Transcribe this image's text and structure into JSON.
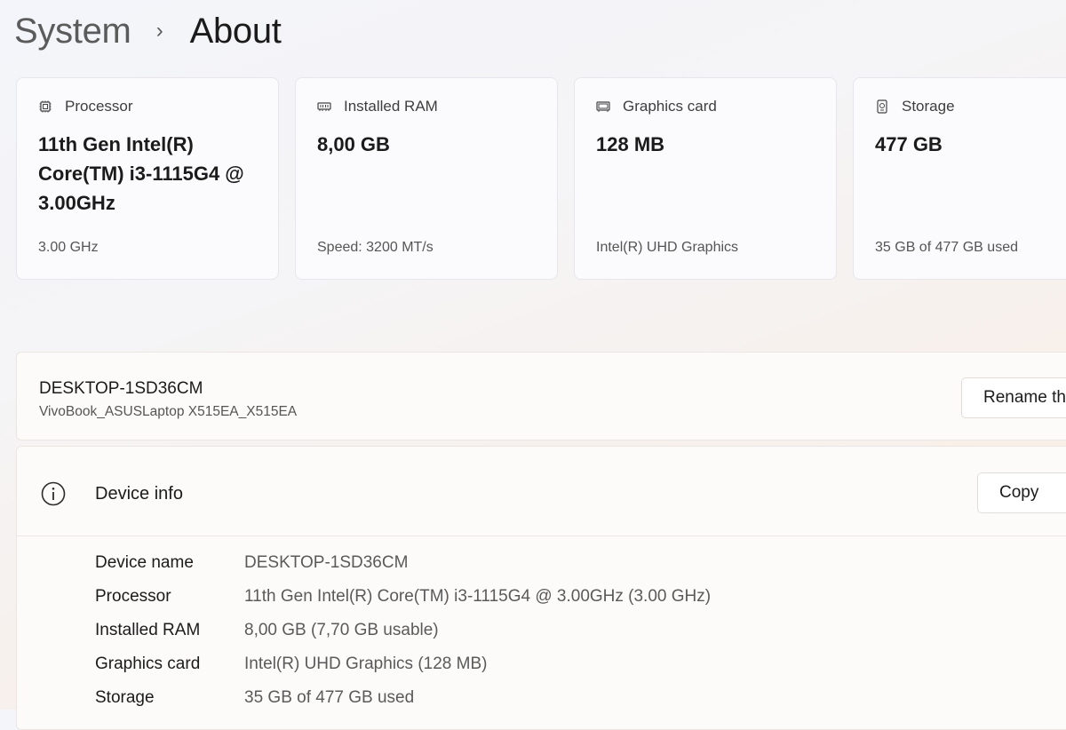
{
  "breadcrumb": {
    "parent": "System",
    "separator": "›",
    "current": "About"
  },
  "cards": [
    {
      "icon": "processor-icon",
      "label": "Processor",
      "value": "11th Gen Intel(R) Core(TM) i3-1115G4 @ 3.00GHz",
      "sub": "3.00 GHz"
    },
    {
      "icon": "ram-icon",
      "label": "Installed RAM",
      "value": "8,00 GB",
      "sub": "Speed: 3200 MT/s"
    },
    {
      "icon": "graphics-card-icon",
      "label": "Graphics card",
      "value": "128 MB",
      "sub": "Intel(R) UHD Graphics"
    },
    {
      "icon": "storage-icon",
      "label": "Storage",
      "value": "477 GB",
      "sub": "35 GB of 477 GB used"
    }
  ],
  "device": {
    "name": "DESKTOP-1SD36CM",
    "model": "VivoBook_ASUSLaptop X515EA_X515EA",
    "rename_label": "Rename this PC"
  },
  "device_info": {
    "icon": "info-icon",
    "title": "Device info",
    "copy_label": "Copy",
    "rows": [
      {
        "label": "Device name",
        "value": "DESKTOP-1SD36CM"
      },
      {
        "label": "Processor",
        "value": "11th Gen Intel(R) Core(TM) i3-1115G4 @ 3.00GHz (3.00 GHz)"
      },
      {
        "label": "Installed RAM",
        "value": "8,00 GB (7,70 GB usable)"
      },
      {
        "label": "Graphics card",
        "value": "Intel(R) UHD Graphics (128 MB)"
      },
      {
        "label": "Storage",
        "value": "35 GB of 477 GB used"
      }
    ]
  }
}
